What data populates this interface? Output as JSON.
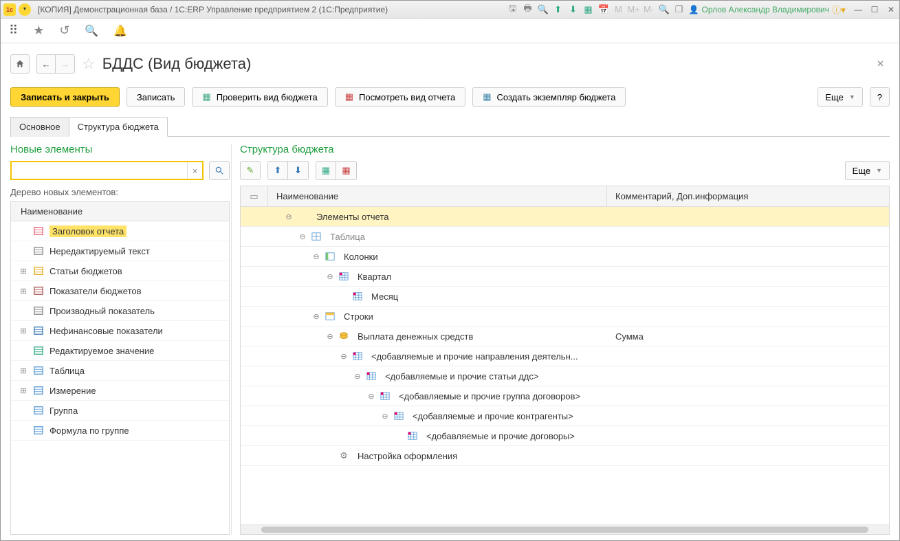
{
  "title": "[КОПИЯ] Демонстрационная база / 1С:ERP Управление предприятием 2  (1С:Предприятие)",
  "user": "Орлов Александр Владимирович",
  "toolbar_m": {
    "m": "M",
    "mp": "M+",
    "mm": "M-"
  },
  "header": {
    "title": "БДДС (Вид бюджета)"
  },
  "cmd": {
    "save_close": "Записать и закрыть",
    "save": "Записать",
    "check": "Проверить вид бюджета",
    "view": "Посмотреть вид отчета",
    "create": "Создать экземпляр бюджета",
    "more": "Еще",
    "help": "?"
  },
  "tabs": {
    "main": "Основное",
    "struct": "Структура бюджета"
  },
  "left": {
    "title": "Новые элементы",
    "tree_label": "Дерево новых элементов:",
    "col": "Наименование",
    "items": [
      {
        "label": "Заголовок отчета",
        "expandable": false,
        "selected": true,
        "icon": "header"
      },
      {
        "label": "Нередактируемый текст",
        "expandable": false,
        "icon": "text"
      },
      {
        "label": "Статьи бюджетов",
        "expandable": true,
        "icon": "coins"
      },
      {
        "label": "Показатели бюджетов",
        "expandable": true,
        "icon": "book"
      },
      {
        "label": "Производный показатель",
        "expandable": false,
        "icon": "fx"
      },
      {
        "label": "Нефинансовые показатели",
        "expandable": true,
        "icon": "chart"
      },
      {
        "label": "Редактируемое значение",
        "expandable": false,
        "icon": "edit"
      },
      {
        "label": "Таблица",
        "expandable": true,
        "icon": "table"
      },
      {
        "label": "Измерение",
        "expandable": true,
        "icon": "dim"
      },
      {
        "label": "Группа",
        "expandable": false,
        "icon": "group"
      },
      {
        "label": "Формула по группе",
        "expandable": false,
        "icon": "formula"
      }
    ]
  },
  "right": {
    "title": "Структура бюджета",
    "more": "Еще",
    "col1": "Наименование",
    "col2": "Комментарий, Доп.информация",
    "rows": [
      {
        "indent": 0,
        "tgl": "m",
        "icon": "",
        "label": "Элементы отчета",
        "comment": "",
        "selected": true
      },
      {
        "indent": 1,
        "tgl": "m",
        "icon": "table",
        "label": "Таблица",
        "comment": "",
        "dim": true
      },
      {
        "indent": 2,
        "tgl": "m",
        "icon": "cols",
        "label": "Колонки",
        "comment": ""
      },
      {
        "indent": 3,
        "tgl": "m",
        "icon": "cal",
        "label": "Квартал",
        "comment": ""
      },
      {
        "indent": 4,
        "tgl": "",
        "icon": "cal",
        "label": "Месяц",
        "comment": ""
      },
      {
        "indent": 2,
        "tgl": "m",
        "icon": "rows",
        "label": "Строки",
        "comment": ""
      },
      {
        "indent": 3,
        "tgl": "m",
        "icon": "coins",
        "label": "Выплата денежных средств",
        "comment": "Сумма"
      },
      {
        "indent": 4,
        "tgl": "m",
        "icon": "cal",
        "label": "<добавляемые и прочие направления деятельн...",
        "comment": ""
      },
      {
        "indent": 5,
        "tgl": "m",
        "icon": "cal",
        "label": "<добавляемые и прочие статьи ддс>",
        "comment": ""
      },
      {
        "indent": 6,
        "tgl": "m",
        "icon": "cal",
        "label": "<добавляемые и прочие группа договоров>",
        "comment": ""
      },
      {
        "indent": 7,
        "tgl": "m",
        "icon": "cal",
        "label": "<добавляемые и прочие контрагенты>",
        "comment": ""
      },
      {
        "indent": 8,
        "tgl": "",
        "icon": "cal",
        "label": "<добавляемые и прочие договоры>",
        "comment": ""
      },
      {
        "indent": 3,
        "tgl": "",
        "icon": "gear",
        "label": "Настройка оформления",
        "comment": ""
      }
    ]
  }
}
